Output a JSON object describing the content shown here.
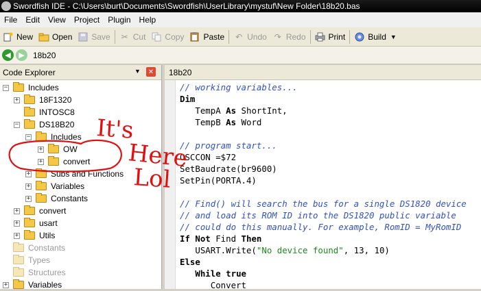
{
  "window": {
    "title": "Swordfish IDE - C:\\Users\\burt\\Documents\\Swordfish\\UserLibrary\\mystuf\\New Folder\\18b20.bas"
  },
  "menu": [
    "File",
    "Edit",
    "View",
    "Project",
    "Plugin",
    "Help"
  ],
  "toolbar": {
    "new": "New",
    "open": "Open",
    "save": "Save",
    "cut": "Cut",
    "copy": "Copy",
    "paste": "Paste",
    "undo": "Undo",
    "redo": "Redo",
    "print": "Print",
    "build": "Build"
  },
  "nav": {
    "current_file": "18b20"
  },
  "explorer": {
    "title": "Code Explorer",
    "items": [
      "Includes",
      "18F1320",
      "INTOSC8",
      "DS18B20",
      "Includes",
      "OW",
      "convert",
      "Subs and Functions",
      "Variables",
      "Constants",
      "convert",
      "usart",
      "Utils",
      "Constants",
      "Types",
      "Structures",
      "Variables"
    ]
  },
  "editor": {
    "tab": "18b20",
    "lines": [
      [
        {
          "t": "// working variables...",
          "c": "cm"
        }
      ],
      [
        {
          "t": "Dim",
          "c": "kw"
        }
      ],
      [
        {
          "t": "   TempA ",
          "c": ""
        },
        {
          "t": "As",
          "c": "kw"
        },
        {
          "t": " ShortInt,",
          "c": ""
        }
      ],
      [
        {
          "t": "   TempB ",
          "c": ""
        },
        {
          "t": "As",
          "c": "kw"
        },
        {
          "t": " Word",
          "c": ""
        }
      ],
      [],
      [
        {
          "t": "// program start...",
          "c": "cm"
        }
      ],
      [
        {
          "t": "OSCCON =$72",
          "c": ""
        }
      ],
      [
        {
          "t": "SetBaudrate(br9600)",
          "c": ""
        }
      ],
      [
        {
          "t": "SetPin(PORTA.4)",
          "c": ""
        }
      ],
      [],
      [
        {
          "t": "// Find() will search the bus for a single DS1820 device",
          "c": "cm"
        }
      ],
      [
        {
          "t": "// and load its ROM ID into the DS1820 public variable",
          "c": "cm"
        }
      ],
      [
        {
          "t": "// could do this manually. For example, RomID = MyRomID",
          "c": "cm"
        }
      ],
      [
        {
          "t": "If Not",
          "c": "kw"
        },
        {
          "t": " Find ",
          "c": ""
        },
        {
          "t": "Then",
          "c": "kw"
        }
      ],
      [
        {
          "t": "   USART.Write(",
          "c": ""
        },
        {
          "t": "\"No device found\"",
          "c": "str"
        },
        {
          "t": ", 13, 10)",
          "c": ""
        }
      ],
      [
        {
          "t": "Else",
          "c": "kw"
        }
      ],
      [
        {
          "t": "   ",
          "c": ""
        },
        {
          "t": "While true",
          "c": "kw"
        }
      ],
      [
        {
          "t": "      Convert",
          "c": ""
        }
      ]
    ]
  },
  "annotation": {
    "words": [
      "It's",
      "Here",
      "Lol"
    ]
  },
  "colors": {
    "comment": "#3050c8",
    "string": "#1a8a1a",
    "annotation": "#e01010"
  }
}
